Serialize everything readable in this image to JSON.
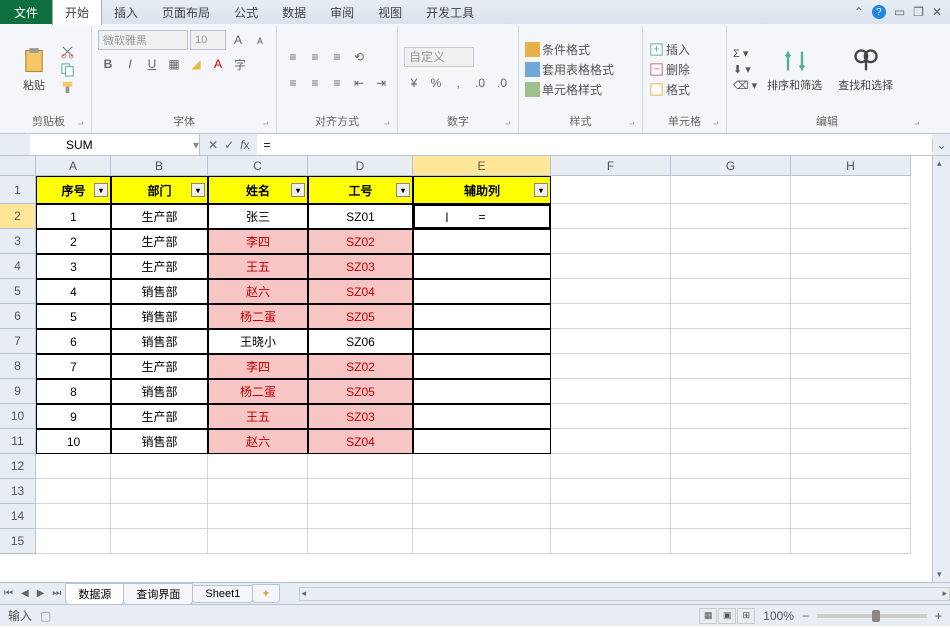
{
  "tabs": {
    "file": "文件",
    "start": "开始",
    "insert": "插入",
    "pagelayout": "页面布局",
    "formulas": "公式",
    "data": "数据",
    "review": "审阅",
    "view": "视图",
    "dev": "开发工具"
  },
  "ribbon": {
    "clipboard": {
      "label": "剪贴板",
      "paste": "粘贴"
    },
    "font": {
      "label": "字体",
      "name": "微软雅黑",
      "size": "10"
    },
    "align": {
      "label": "对齐方式",
      "custom": "自定义"
    },
    "number": {
      "label": "数字"
    },
    "styles": {
      "label": "样式",
      "cond": "条件格式",
      "table": "套用表格格式",
      "cell": "单元格样式"
    },
    "cells": {
      "label": "单元格",
      "insert": "插入",
      "delete": "删除",
      "format": "格式"
    },
    "editing": {
      "label": "编辑",
      "sort": "排序和筛选",
      "find": "查找和选择"
    }
  },
  "namebox": "SUM",
  "formula": "=",
  "columns": [
    "A",
    "B",
    "C",
    "D",
    "E",
    "F",
    "G",
    "H"
  ],
  "headers": [
    "序号",
    "部门",
    "姓名",
    "工号",
    "辅助列"
  ],
  "rows": [
    {
      "n": "1",
      "dept": "生产部",
      "name": "张三",
      "id": "SZ01",
      "pink": false
    },
    {
      "n": "2",
      "dept": "生产部",
      "name": "李四",
      "id": "SZ02",
      "pink": true
    },
    {
      "n": "3",
      "dept": "生产部",
      "name": "王五",
      "id": "SZ03",
      "pink": true
    },
    {
      "n": "4",
      "dept": "销售部",
      "name": "赵六",
      "id": "SZ04",
      "pink": true
    },
    {
      "n": "5",
      "dept": "销售部",
      "name": "杨二蛋",
      "id": "SZ05",
      "pink": true
    },
    {
      "n": "6",
      "dept": "销售部",
      "name": "王晓小",
      "id": "SZ06",
      "pink": false
    },
    {
      "n": "7",
      "dept": "生产部",
      "name": "李四",
      "id": "SZ02",
      "pink": true
    },
    {
      "n": "8",
      "dept": "销售部",
      "name": "杨二蛋",
      "id": "SZ05",
      "pink": true
    },
    {
      "n": "9",
      "dept": "生产部",
      "name": "王五",
      "id": "SZ03",
      "pink": true
    },
    {
      "n": "10",
      "dept": "销售部",
      "name": "赵六",
      "id": "SZ04",
      "pink": true
    }
  ],
  "edit_cell": "=",
  "sheets": {
    "s1": "数据源",
    "s2": "查询界面",
    "s3": "Sheet1"
  },
  "status": {
    "mode": "输入",
    "zoom": "100%"
  }
}
